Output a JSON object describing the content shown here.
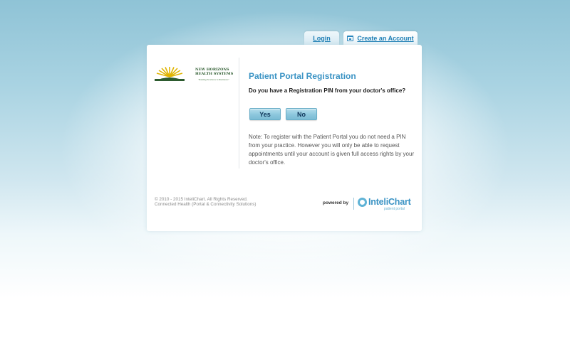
{
  "tabs": {
    "login": "Login",
    "create_account": "Create an Account"
  },
  "logo": {
    "line1": "NEW HORIZONS",
    "line2": "HEALTH SYSTEMS",
    "tagline": "\"Building Excellence in Healthcare\""
  },
  "main": {
    "title": "Patient Portal Registration",
    "question": "Do you have a Registration PIN from your doctor's office?",
    "yes_label": "Yes",
    "no_label": "No",
    "note": "Note: To register with the Patient Portal you do not need a PIN from your practice. However you will only be able to request appointments until your account is given full access rights by your doctor's office."
  },
  "footer": {
    "copyright": "© 2010 - 2015 InteliChart. All Rights Reserved.",
    "subline": "Connected Health (Portal & Connectivity Solutions)",
    "powered_by": "powered by",
    "brand_name": "InteliChart",
    "brand_sub": "patient portal"
  },
  "colors": {
    "accent": "#3a93c4",
    "button": "#8cc7dd",
    "logo_green": "#2d5b2f",
    "logo_sun": "#e0b400"
  }
}
